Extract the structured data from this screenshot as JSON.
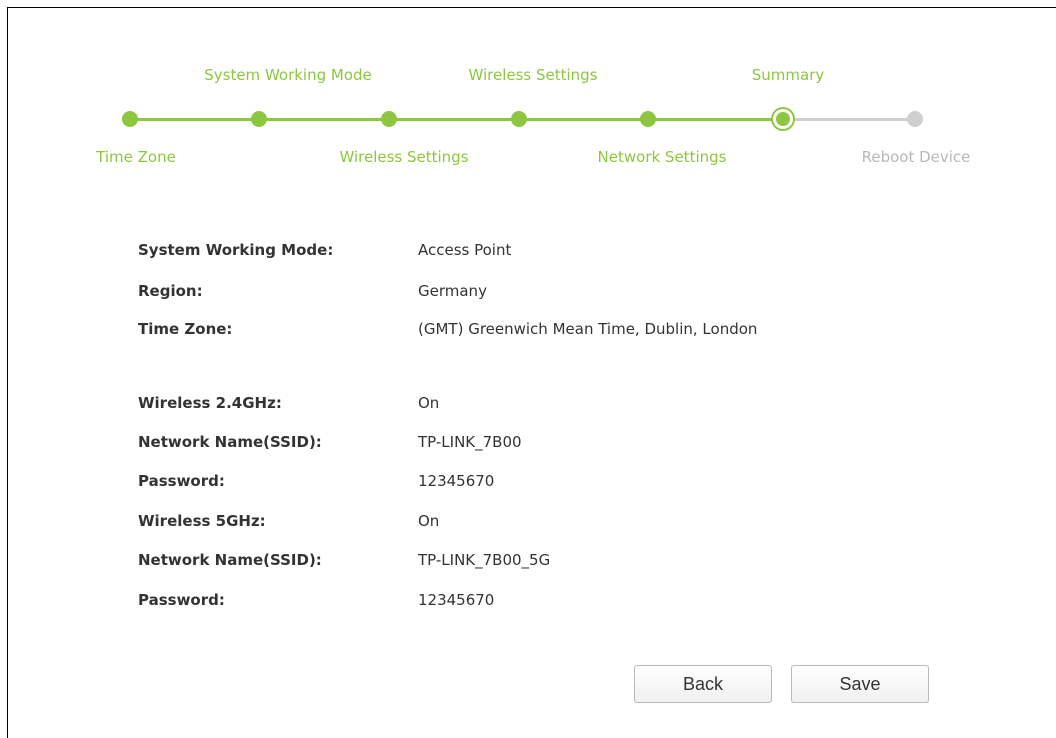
{
  "stepper": {
    "top_labels": [
      "System Working Mode",
      "Wireless Settings",
      "Summary"
    ],
    "bottom_labels": [
      "Time Zone",
      "Wireless Settings",
      "Network Settings",
      "Reboot Device"
    ],
    "current_step": "Summary",
    "accent_color": "#8dc63f",
    "inactive_color": "#cfcfcf"
  },
  "summary": {
    "rows": [
      {
        "label": "System Working Mode:",
        "value": "Access Point"
      },
      {
        "label": "Region:",
        "value": "Germany"
      },
      {
        "label": "Time Zone:",
        "value": "(GMT) Greenwich Mean Time, Dublin, London"
      },
      {
        "label": "Wireless 2.4GHz:",
        "value": "On"
      },
      {
        "label": "Network Name(SSID):",
        "value": "TP-LINK_7B00"
      },
      {
        "label": "Password:",
        "value": "12345670"
      },
      {
        "label": "Wireless 5GHz:",
        "value": "On"
      },
      {
        "label": "Network Name(SSID):",
        "value": "TP-LINK_7B00_5G"
      },
      {
        "label": "Password:",
        "value": "12345670"
      }
    ]
  },
  "buttons": {
    "back_label": "Back",
    "save_label": "Save"
  }
}
